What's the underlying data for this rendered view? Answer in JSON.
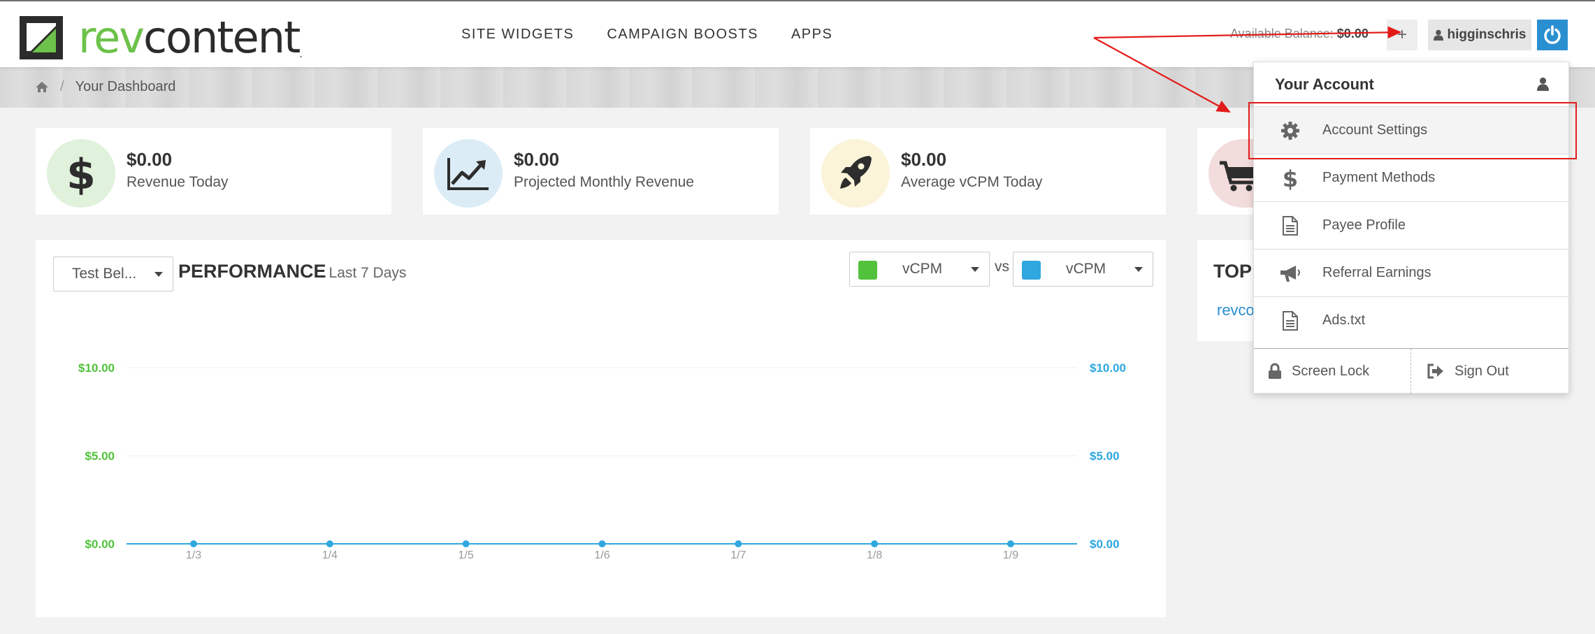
{
  "header": {
    "logo_rev": "rev",
    "logo_content": "content",
    "logo_dot": ".",
    "nav": [
      "SITE WIDGETS",
      "CAMPAIGN BOOSTS",
      "APPS"
    ],
    "balance_label": "Available Balance:",
    "balance_value": "$0.00",
    "plus": "+",
    "username": "higginschris"
  },
  "breadcrumb": {
    "current": "Your Dashboard",
    "separator": "/"
  },
  "stats": [
    {
      "value": "$0.00",
      "label": "Revenue Today",
      "icon": "dollar-icon"
    },
    {
      "value": "$0.00",
      "label": "Projected Monthly Revenue",
      "icon": "trend-chart-icon"
    },
    {
      "value": "$0.00",
      "label": "Average vCPM Today",
      "icon": "rocket-icon"
    }
  ],
  "performance": {
    "widget_select": "Test Bel...",
    "title": "PERFORMANCE",
    "subtitle": "Last 7 Days",
    "metric_left": "vCPM",
    "vs": "vs",
    "metric_right": "vCPM"
  },
  "chart_data": {
    "type": "line",
    "categories": [
      "1/3",
      "1/4",
      "1/5",
      "1/6",
      "1/7",
      "1/8",
      "1/9"
    ],
    "series": [
      {
        "values": [
          0,
          0,
          0,
          0,
          0,
          0,
          0
        ],
        "color": "#2fa7df"
      }
    ],
    "y_left_ticks": [
      "$10.00",
      "$5.00",
      "$0.00"
    ],
    "y_right_ticks": [
      "$10.00",
      "$5.00",
      "$0.00"
    ],
    "ylim": [
      0,
      10
    ],
    "grid": true
  },
  "top_panel": {
    "title": "TOP",
    "link": "revco"
  },
  "dropdown": {
    "header": "Your Account",
    "items": [
      {
        "label": "Account Settings",
        "icon": "gear-icon"
      },
      {
        "label": "Payment Methods",
        "icon": "dollar-icon"
      },
      {
        "label": "Payee Profile",
        "icon": "document-icon"
      },
      {
        "label": "Referral Earnings",
        "icon": "megaphone-icon"
      },
      {
        "label": "Ads.txt",
        "icon": "document-icon"
      }
    ],
    "screen_lock": "Screen Lock",
    "sign_out": "Sign Out"
  },
  "colors": {
    "brand_green": "#6cc24a",
    "accent_blue": "#2a8fd1",
    "series_green": "#52c23c",
    "series_blue": "#2fa7df",
    "annotation_red": "#e31a1a"
  }
}
